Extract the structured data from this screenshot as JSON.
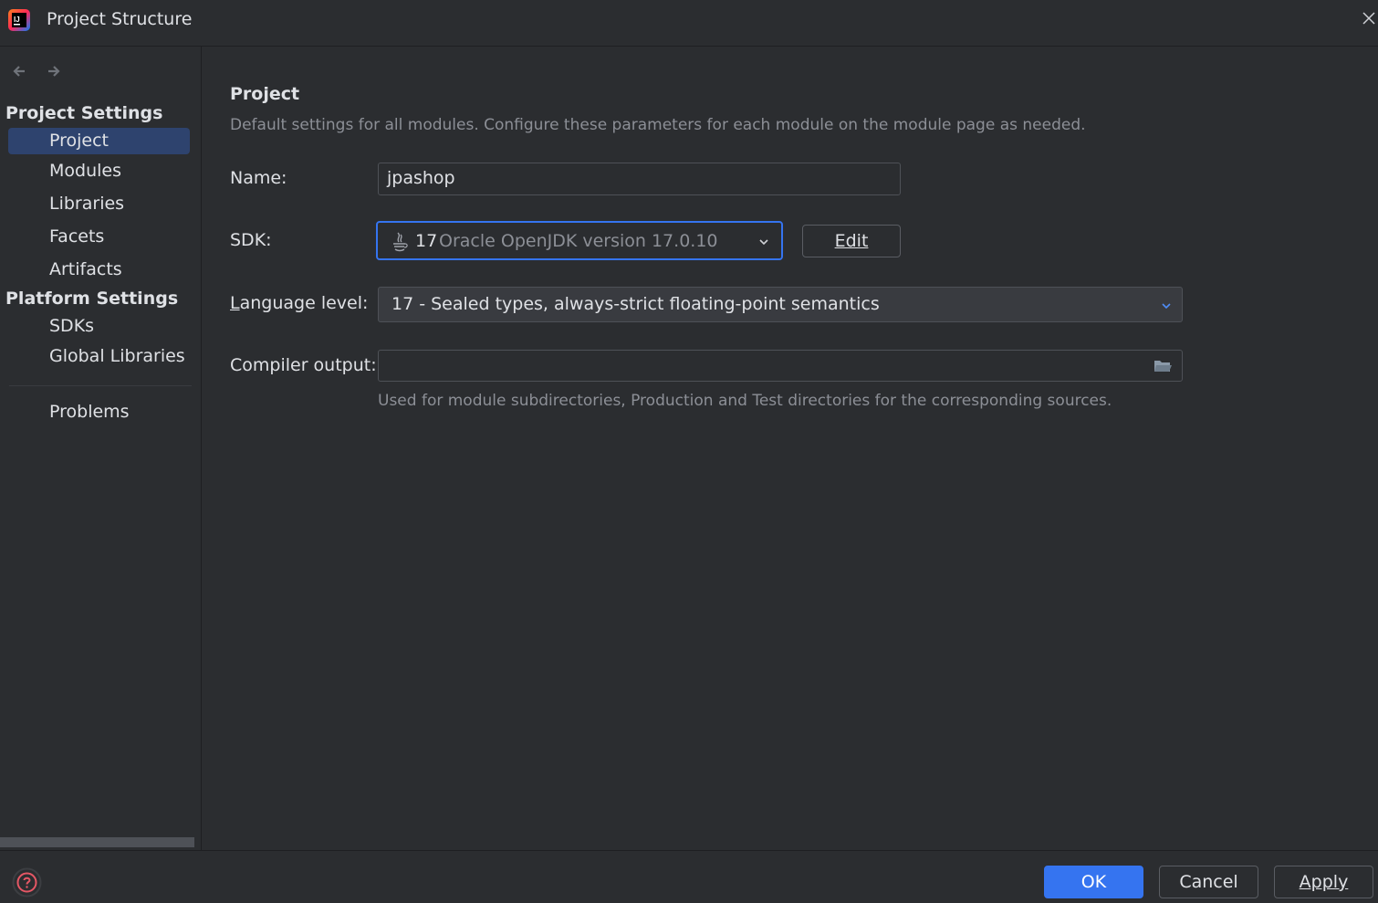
{
  "window": {
    "title": "Project Structure",
    "app_icon": "intellij-idea-icon",
    "close_icon": "close-icon"
  },
  "sidebar": {
    "back_icon": "arrow-left-icon",
    "forward_icon": "arrow-right-icon",
    "project_settings_label": "Project Settings",
    "project_items": [
      {
        "label": "Project",
        "selected": true
      },
      {
        "label": "Modules"
      },
      {
        "label": "Libraries"
      },
      {
        "label": "Facets"
      },
      {
        "label": "Artifacts"
      }
    ],
    "platform_settings_label": "Platform Settings",
    "platform_items": [
      {
        "label": "SDKs"
      },
      {
        "label": "Global Libraries"
      }
    ],
    "problems_label": "Problems"
  },
  "main": {
    "title": "Project",
    "description": "Default settings for all modules. Configure these parameters for each module on the module page as needed.",
    "name_label": "Name:",
    "name_value": "jpashop",
    "sdk_label": "SDK:",
    "sdk_version": "17",
    "sdk_name": "Oracle OpenJDK version 17.0.10",
    "sdk_icon": "java-icon",
    "edit_label": "Edit",
    "language_label_mnemonic": "L",
    "language_label_rest": "anguage level:",
    "language_value": "17 - Sealed types, always-strict floating-point semantics",
    "compiler_label": "Compiler output:",
    "compiler_value": "",
    "compiler_hint": "Used for module subdirectories, Production and Test directories for the corresponding sources."
  },
  "footer": {
    "help_icon": "help-icon",
    "ok_label": "OK",
    "cancel_label": "Cancel",
    "apply_label": "Apply"
  },
  "colors": {
    "background": "#2b2d30",
    "selection": "#2e436e",
    "accent": "#3574f0",
    "text": "#dfe1e5",
    "muted_text": "#8c8f96"
  }
}
